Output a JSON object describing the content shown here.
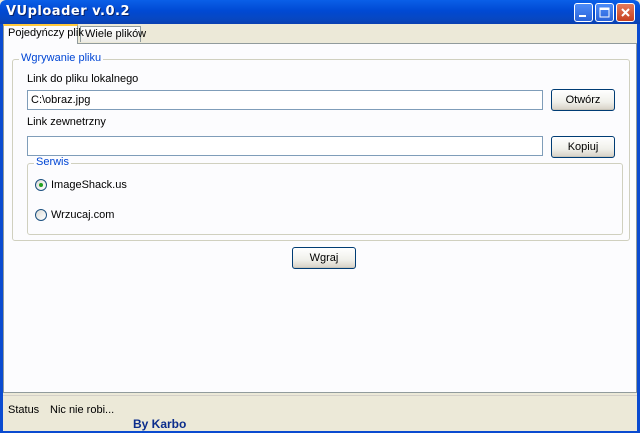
{
  "window": {
    "title": "VUploader v.0.2"
  },
  "tabs": [
    {
      "label": "Pojedyńczy plik",
      "active": true
    },
    {
      "label": "Wiele plików",
      "active": false
    }
  ],
  "upload_group": {
    "legend": "Wgrywanie pliku",
    "local_label": "Link do pliku lokalnego",
    "local_value": "C:\\obraz.jpg",
    "open_button": "Otwórz",
    "external_label": "Link zewnetrzny",
    "external_value": "",
    "copy_button": "Kopiuj"
  },
  "service_group": {
    "legend": "Serwis",
    "options": [
      {
        "label": "ImageShack.us",
        "checked": true
      },
      {
        "label": "Wrzucaj.com",
        "checked": false
      }
    ]
  },
  "upload_button": "Wgraj",
  "status": {
    "label": "Status",
    "text": "Nic nie robi..."
  },
  "credit": "By Karbo",
  "colors": {
    "title_bar": "#0a5fe8",
    "accent": "#0046d5",
    "close_button": "#c7401f"
  },
  "icons": [
    "minimize-icon",
    "maximize-icon",
    "close-icon"
  ]
}
